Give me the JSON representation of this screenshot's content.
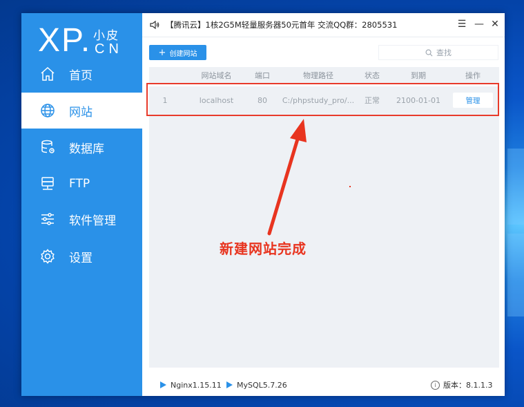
{
  "logo": {
    "main": "XP",
    "dot": ".",
    "small": "小皮",
    "suffix": "CN"
  },
  "sidebar": {
    "items": [
      {
        "label": "首页",
        "icon": "home-icon",
        "active": false
      },
      {
        "label": "网站",
        "icon": "globe-icon",
        "active": true
      },
      {
        "label": "数据库",
        "icon": "database-icon",
        "active": false
      },
      {
        "label": "FTP",
        "icon": "ftp-icon",
        "active": false
      },
      {
        "label": "软件管理",
        "icon": "sliders-icon",
        "active": false
      },
      {
        "label": "设置",
        "icon": "gear-icon",
        "active": false
      }
    ]
  },
  "titlebar": {
    "notice": "【腾讯云】1核2G5M轻量服务器50元首年 交流QQ群：2805531",
    "menu_icon": "☰",
    "minimize_icon": "—",
    "close_icon": "✕"
  },
  "toolbar": {
    "create_label": "创建网站",
    "search_placeholder": "查找"
  },
  "table": {
    "headers": [
      "网站域名",
      "端口",
      "物理路径",
      "状态",
      "到期",
      "操作"
    ],
    "rows": [
      {
        "index": "1",
        "domain": "localhost",
        "port": "80",
        "path": "C:/phpstudy_pro/...",
        "status": "正常",
        "expire": "2100-01-01",
        "action": "管理"
      }
    ]
  },
  "statusbar": {
    "nginx": "Nginx1.15.11",
    "mysql": "MySQL5.7.26",
    "version": "版本：8.1.1.3"
  },
  "annotation": {
    "caption": "新建网站完成"
  },
  "colors": {
    "accent": "#2a91e8",
    "highlight": "#e83a2a",
    "desktop": "#0a55c8"
  }
}
